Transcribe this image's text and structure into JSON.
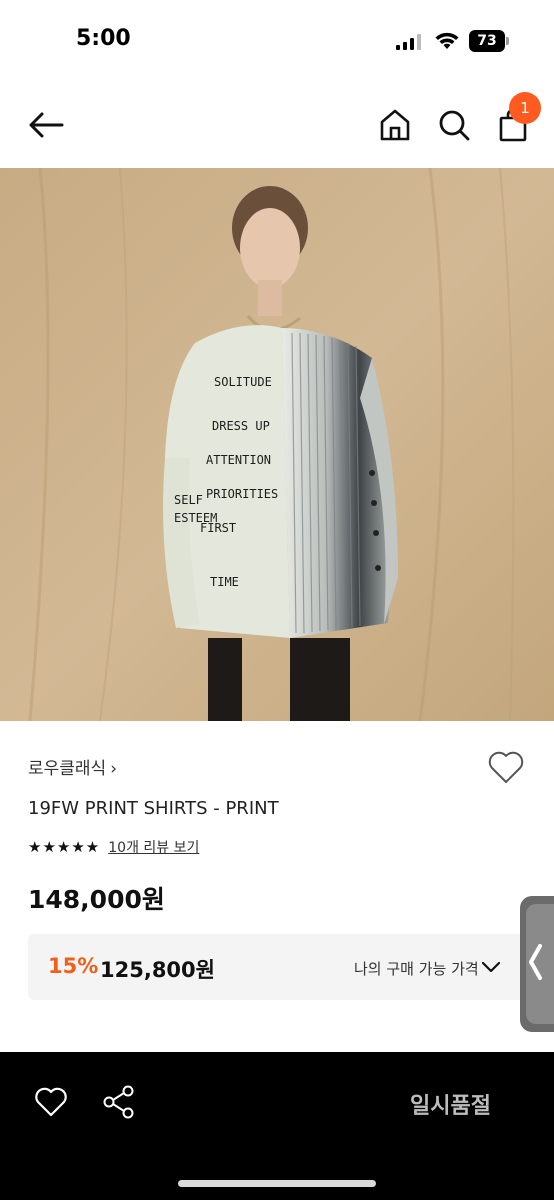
{
  "status_bar": {
    "time": "5:00",
    "battery": "73",
    "icons": [
      "signal-icon",
      "wifi-icon",
      "battery-icon"
    ]
  },
  "header": {
    "icons": [
      "back-arrow-icon",
      "home-icon",
      "search-icon",
      "shopping-bag-icon"
    ],
    "cart_count": "1",
    "badge_color": "#ff5a1f"
  },
  "product": {
    "brand": "로우클래식",
    "brand_chevron": "›",
    "name": "19FW PRINT SHIRTS - PRINT",
    "rating_stars": "★★★★★",
    "review_link": "10개 리뷰 보기",
    "price": "148,000원",
    "discount": {
      "rate": "15%",
      "price": "125,800원",
      "label": "나의 구매 가능 가격"
    },
    "shirt_print_text": [
      "SOLITUDE",
      "DRESS UP",
      "ATTENTION",
      "PRIORITIES",
      "SELF",
      "ESTEEM",
      "FIRST",
      "TIME"
    ]
  },
  "bottom_bar": {
    "icons": [
      "heart-icon",
      "share-icon"
    ],
    "sold_out_label": "일시품절"
  },
  "colors": {
    "accent": "#f0601a",
    "bottom_bar_bg": "#000000"
  }
}
